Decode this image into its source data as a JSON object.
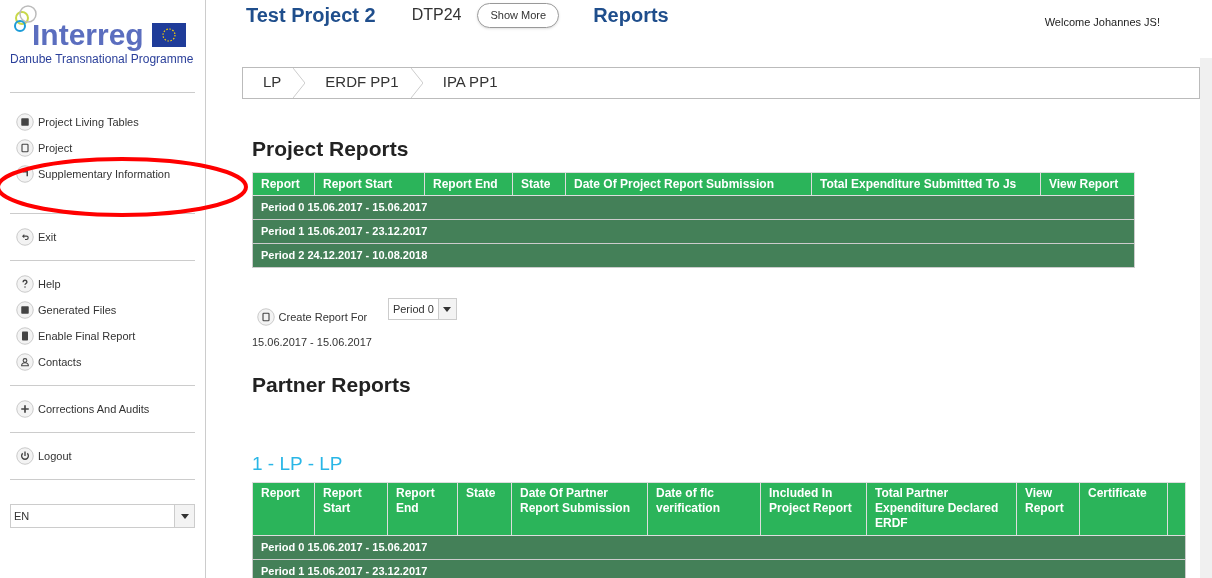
{
  "logo": {
    "name": "Interreg",
    "subtitle": "Danube Transnational Programme"
  },
  "header": {
    "project_title": "Test Project 2",
    "project_code": "DTP24",
    "show_more_button": "Show More",
    "page_title": "Reports",
    "welcome": "Welcome Johannes JS!"
  },
  "sidebar": {
    "groups": [
      [
        {
          "label": "Project Living Tables",
          "kind": "table"
        },
        {
          "label": "Project",
          "kind": "doc"
        },
        {
          "label": "Supplementary Information",
          "kind": "corner"
        }
      ],
      [
        {
          "label": "Exit",
          "kind": "back"
        }
      ],
      [
        {
          "label": "Help",
          "kind": "help"
        },
        {
          "label": "Generated Files",
          "kind": "save"
        },
        {
          "label": "Enable Final Report",
          "kind": "book"
        },
        {
          "label": "Contacts",
          "kind": "user"
        }
      ],
      [
        {
          "label": "Corrections And Audits",
          "kind": "plus"
        }
      ],
      [
        {
          "label": "Logout",
          "kind": "power"
        }
      ]
    ],
    "language": "EN"
  },
  "annotation": {
    "color": "#ff0000"
  },
  "breadcrumb": [
    {
      "label": "LP"
    },
    {
      "label": "ERDF PP1"
    },
    {
      "label": "IPA PP1"
    }
  ],
  "project_reports": {
    "title": "Project Reports",
    "columns": [
      "Report",
      "Report Start",
      "Report End",
      "State",
      "Date Of Project Report Submission",
      "Total Expenditure Submitted To Js",
      "View Report"
    ],
    "rows": [
      "Period 0 15.06.2017 - 15.06.2017",
      "Period 1 15.06.2017 - 23.12.2017",
      "Period 2 24.12.2017 - 10.08.2018"
    ]
  },
  "create_report": {
    "label": "Create Report For",
    "period_select": "Period 0",
    "date_range": "15.06.2017 - 15.06.2017"
  },
  "partner_reports": {
    "title": "Partner Reports",
    "partner": "1 - LP - LP",
    "columns": [
      "Report",
      "Report Start",
      "Report End",
      "State",
      "Date Of Partner Report Submission",
      "Date of flc verification",
      "Included In Project Report",
      "Total Partner Expenditure Declared ERDF",
      "View Report",
      "Certificate"
    ],
    "rows": [
      "Period 0 15.06.2017 - 15.06.2017",
      "Period 1 15.06.2017 - 23.12.2017"
    ]
  }
}
